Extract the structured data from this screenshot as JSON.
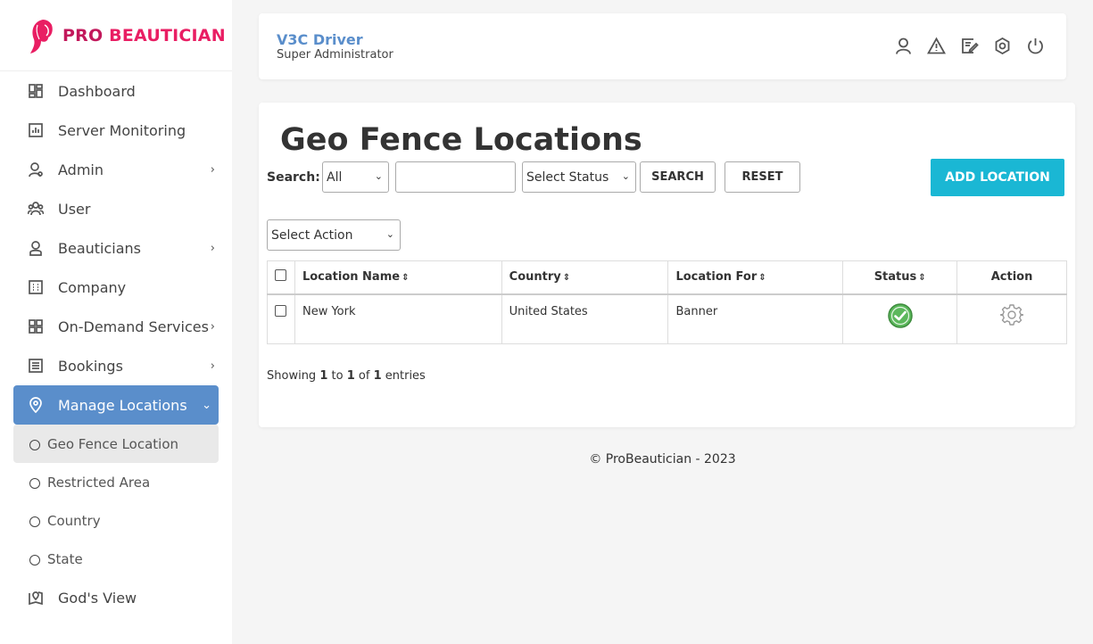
{
  "brand": {
    "word1": "PRO",
    "word2": "BEAUTICIAN"
  },
  "sidebar": {
    "items": [
      {
        "label": "Dashboard",
        "icon": "dashboard-icon",
        "chevron": false
      },
      {
        "label": "Server Monitoring",
        "icon": "chart-icon",
        "chevron": false
      },
      {
        "label": "Admin",
        "icon": "admin-icon",
        "chevron": true
      },
      {
        "label": "User",
        "icon": "users-icon",
        "chevron": false
      },
      {
        "label": "Beauticians",
        "icon": "person-icon",
        "chevron": true
      },
      {
        "label": "Company",
        "icon": "building-icon",
        "chevron": false
      },
      {
        "label": "On-Demand Services",
        "icon": "grid-icon",
        "chevron": true
      },
      {
        "label": "Bookings",
        "icon": "list-icon",
        "chevron": true
      },
      {
        "label": "Manage Locations",
        "icon": "location-icon",
        "chevron": true
      }
    ],
    "sub_items": [
      "Geo Fence Location",
      "Restricted Area",
      "Country",
      "State"
    ],
    "last_item": {
      "label": "God's View",
      "icon": "map-icon"
    }
  },
  "header": {
    "user_name": "V3C Driver",
    "user_role": "Super Administrator"
  },
  "main": {
    "title": "Geo Fence Locations",
    "search_label": "Search:",
    "search_field_value": "All",
    "status_placeholder": "Select Status",
    "search_button": "SEARCH",
    "reset_button": "RESET",
    "add_button": "ADD LOCATION",
    "action_select": "Select Action"
  },
  "table": {
    "headers": [
      "Location Name",
      "Country",
      "Location For",
      "Status",
      "Action"
    ],
    "rows": [
      {
        "location_name": "New York",
        "country": "United States",
        "location_for": "Banner"
      }
    ]
  },
  "pagination": {
    "showing": "Showing",
    "from": "1",
    "to_word": "to",
    "to": "1",
    "of_word": "of",
    "total": "1",
    "entries": "entries"
  },
  "footer": "© ProBeautician - 2023",
  "colors": {
    "accent": "#5a8ecb",
    "add_button": "#1ab7d4",
    "brand_pink": "#e91e63",
    "status_green": "#5cb85c"
  }
}
